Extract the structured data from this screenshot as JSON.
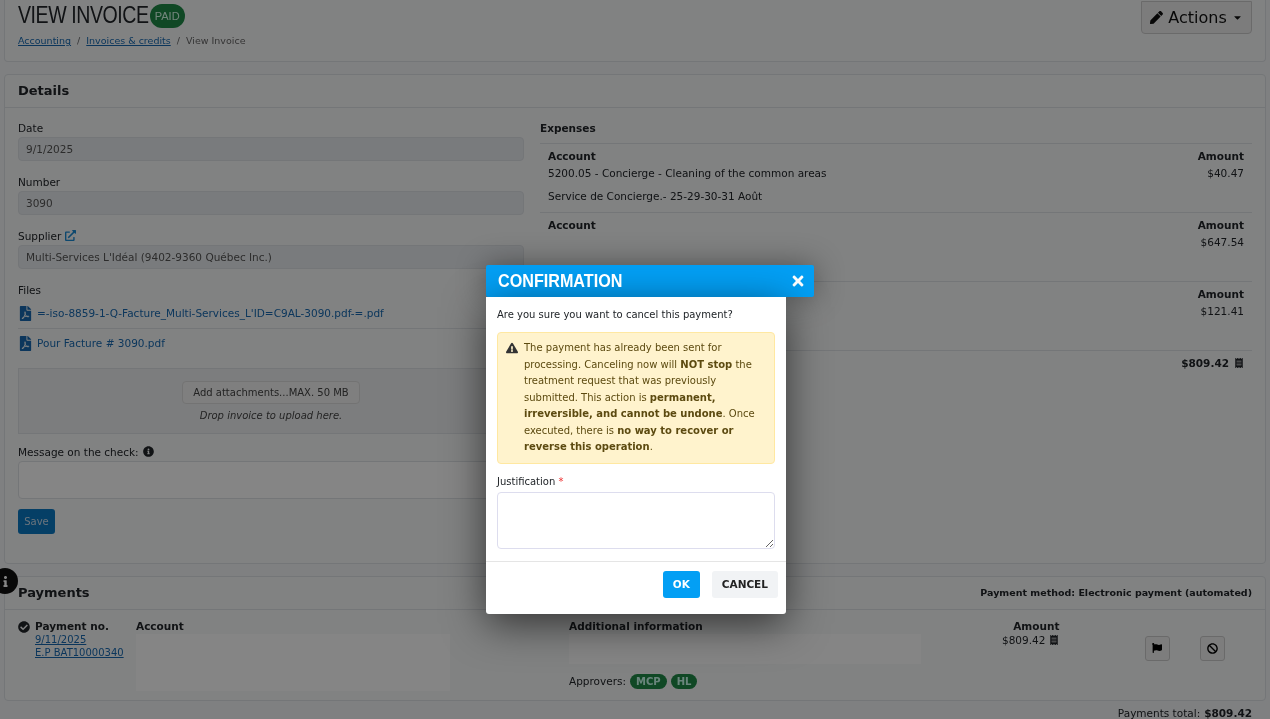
{
  "header": {
    "title": "VIEW INVOICE",
    "status": "PAID",
    "breadcrumb_separator": "/",
    "breadcrumbs": [
      {
        "label": "Accounting",
        "link": true
      },
      {
        "label": "Invoices & credits",
        "link": true
      },
      {
        "label": "View Invoice",
        "link": false
      }
    ],
    "actions_button": "Actions"
  },
  "details": {
    "title": "Details",
    "fields": [
      {
        "label": "Date",
        "value": "9/1/2025",
        "external_link": false
      },
      {
        "label": "Number",
        "value": "3090",
        "external_link": false
      },
      {
        "label": "Supplier",
        "value": "Multi-Services L'Idéal (9402-9360 Québec Inc.)",
        "external_link": true
      }
    ],
    "files_label": "Files",
    "files": [
      "=-iso-8859-1-Q-Facture_Multi-Services_L'ID=C9AL-3090.pdf-=.pdf",
      "Pour Facture # 3090.pdf"
    ],
    "upload": {
      "button": "Add attachments...MAX. 50 MB",
      "hint": "Drop invoice to upload here."
    },
    "message_label": "Message on the check:",
    "save_button": "Save"
  },
  "expenses": {
    "title": "Expenses",
    "rows": [
      {
        "account_header": "Account",
        "amount_header": "Amount",
        "account": "5200.05 - Concierge - Cleaning of the common areas",
        "amount": "$40.47",
        "note": "Service de Concierge.- 25-29-30-31 Août"
      },
      {
        "account_header": "Account",
        "amount_header": "Amount",
        "amount": "$647.54"
      },
      {
        "amount_header": "Amount",
        "amount": "$121.41"
      }
    ],
    "total": "$809.42"
  },
  "payments": {
    "title": "Payments",
    "method": "Payment method: Electronic payment (automated)",
    "columns": [
      "Payment no.",
      "Account",
      "Additional information",
      "Amount"
    ],
    "rows": [
      {
        "date": "9/11/2025",
        "reference": "E.P BAT10000340",
        "amount": "$809.42",
        "approvers_label": "Approvers:",
        "approvers": [
          "MCP",
          "HL"
        ]
      }
    ],
    "total_label": "Payments total:",
    "total": "$809.42"
  },
  "modal": {
    "title": "CONFIRMATION",
    "question": "Are you sure you want to cancel this payment?",
    "warning": "The payment has already been sent for processing. Canceling now will **NOT stop** the treatment request that was previously submitted. This action is **permanent, irreversible, and cannot be undone**. Once executed, there is **no way to recover or reverse this operation**.",
    "justification_label": "Justification",
    "required_mark": "*",
    "buttons": [
      {
        "label": "OK",
        "kind": "primary"
      },
      {
        "label": "CANCEL",
        "kind": "secondary"
      }
    ]
  }
}
